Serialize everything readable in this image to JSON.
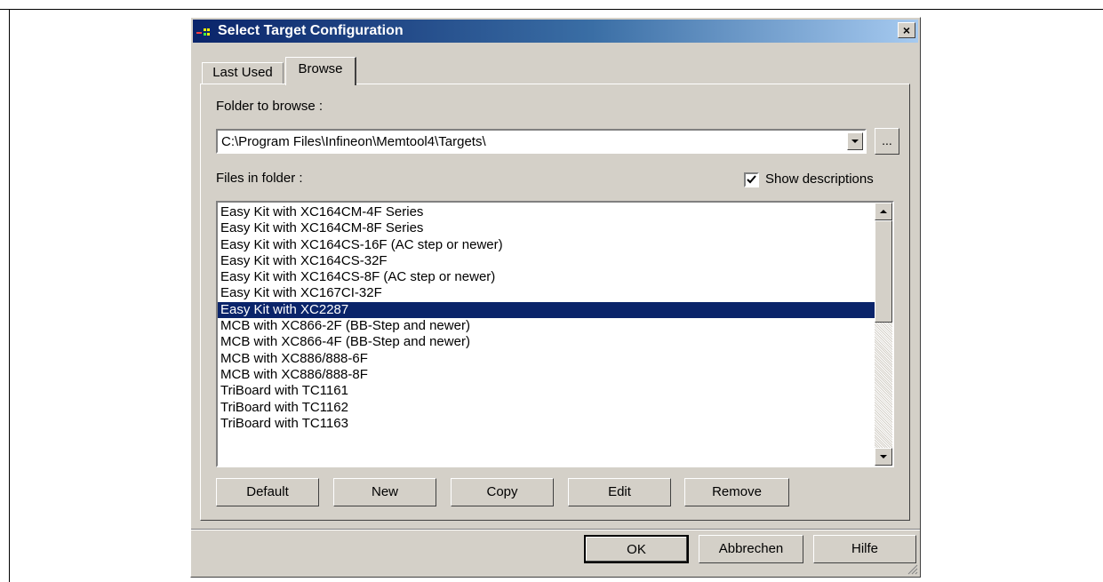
{
  "dialog": {
    "title": "Select Target Configuration",
    "close_label": "×"
  },
  "tabs": [
    {
      "label": "Last Used",
      "active": false
    },
    {
      "label": "Browse",
      "active": true
    }
  ],
  "browse": {
    "folder_label": "Folder to browse :",
    "folder_value": "C:\\Program Files\\Infineon\\Memtool4\\Targets\\",
    "browse_button": "...",
    "files_label": "Files in folder :",
    "show_descriptions_label": "Show descriptions",
    "show_descriptions_checked": true
  },
  "files": [
    "Easy Kit with XC164CM-4F Series",
    "Easy Kit with XC164CM-8F Series",
    "Easy Kit with XC164CS-16F (AC step or newer)",
    "Easy Kit with XC164CS-32F",
    "Easy Kit with XC164CS-8F (AC step or newer)",
    "Easy Kit with XC167CI-32F",
    "Easy Kit with XC2287",
    "MCB with XC866-2F (BB-Step and newer)",
    "MCB with XC866-4F (BB-Step and newer)",
    "MCB with XC886/888-6F",
    "MCB with XC886/888-8F",
    "TriBoard with TC1161",
    "TriBoard with TC1162",
    "TriBoard with TC1163"
  ],
  "selected_file_index": 6,
  "action_buttons": {
    "default": "Default",
    "new": "New",
    "copy": "Copy",
    "edit": "Edit",
    "remove": "Remove"
  },
  "dialog_buttons": {
    "ok": "OK",
    "cancel": "Abbrechen",
    "help": "Hilfe"
  },
  "colors": {
    "selection": "#0a246a",
    "dialog_bg": "#d4d0c8"
  }
}
